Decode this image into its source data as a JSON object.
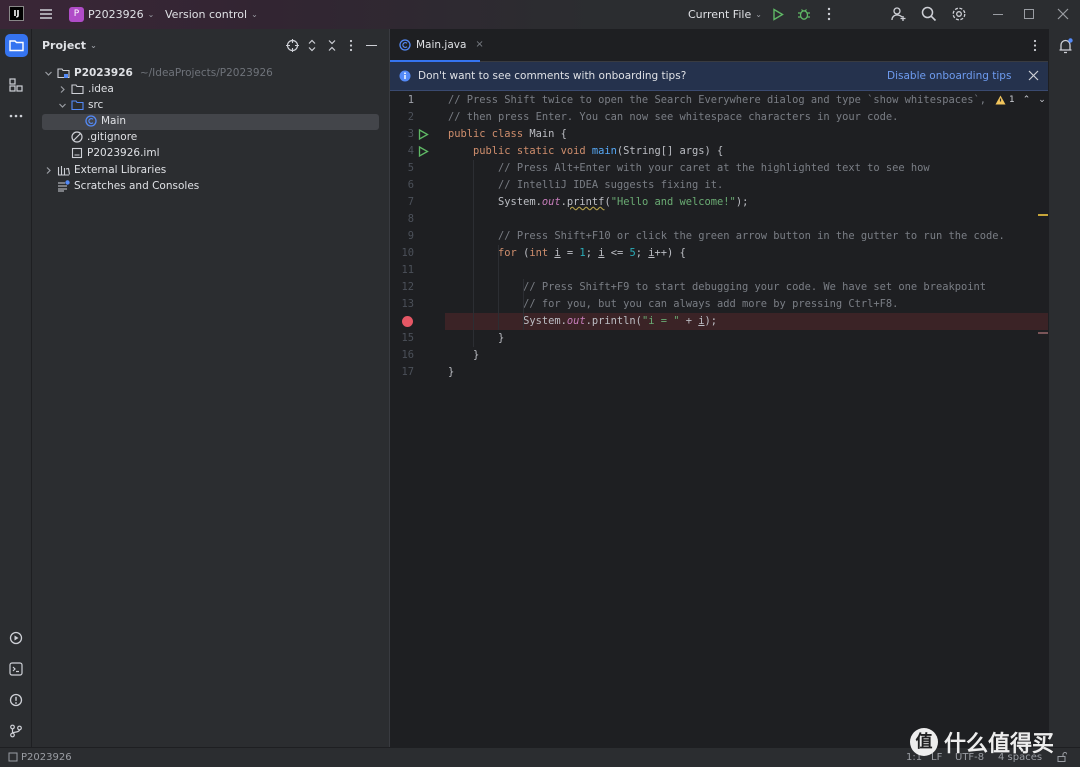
{
  "titlebar": {
    "app_logo": "IJ",
    "project_badge": "P",
    "project_name": "P2023926",
    "vcs": "Version control",
    "run_config": "Current File",
    "icons": [
      "menu-icon",
      "run-icon",
      "debug-icon",
      "more-icon",
      "add-user-icon",
      "search-icon",
      "settings-icon",
      "minimize-icon",
      "maximize-icon",
      "close-icon"
    ]
  },
  "project_panel": {
    "title": "Project",
    "tree": [
      {
        "label": "P2023926",
        "hint": "~/IdeaProjects/P2023926",
        "type": "project",
        "expanded": true,
        "depth": 0
      },
      {
        "label": ".idea",
        "type": "folder",
        "expanded": false,
        "depth": 1
      },
      {
        "label": "src",
        "type": "source-folder",
        "expanded": true,
        "depth": 1
      },
      {
        "label": "Main",
        "type": "class",
        "depth": 2,
        "selected": true
      },
      {
        "label": ".gitignore",
        "type": "ignore-file",
        "depth": 1
      },
      {
        "label": "P2023926.iml",
        "type": "module-file",
        "depth": 1
      },
      {
        "label": "External Libraries",
        "type": "libraries",
        "expanded": false,
        "depth": 0
      },
      {
        "label": "Scratches and Consoles",
        "type": "scratches",
        "depth": 0
      }
    ]
  },
  "editor": {
    "tab": "Main.java",
    "banner": {
      "text": "Don't want to see comments with onboarding tips?",
      "action": "Disable onboarding tips"
    },
    "warnings": "1",
    "current_line": 1,
    "breakpoint_line": 14,
    "run_gutter_lines": [
      3,
      4
    ],
    "lines": [
      [
        [
          "// Press Shift twice to open the Search Everywhere dialog and type `show whitespaces`,",
          "c"
        ]
      ],
      [
        [
          "// then press Enter. You can now see whitespace characters in your code.",
          "c"
        ]
      ],
      [
        [
          "public class ",
          "k"
        ],
        [
          "Main {",
          "p"
        ]
      ],
      [
        [
          "    public static void ",
          "k"
        ],
        [
          "main",
          "f"
        ],
        [
          "(String[] args) {",
          "p"
        ]
      ],
      [
        [
          "        // Press Alt+Enter with your caret at the highlighted text to see how",
          "c"
        ]
      ],
      [
        [
          "        // IntelliJ IDEA suggests fixing it.",
          "c"
        ]
      ],
      [
        [
          "        System.",
          "p"
        ],
        [
          "out",
          "st"
        ],
        [
          ".",
          "p"
        ],
        [
          "printf",
          "w"
        ],
        [
          "(",
          "p"
        ],
        [
          "\"Hello and welcome!\"",
          "s"
        ],
        [
          ");",
          "p"
        ]
      ],
      [],
      [
        [
          "        // Press Shift+F10 or click the green arrow button in the gutter to run the code.",
          "c"
        ]
      ],
      [
        [
          "        for ",
          "k"
        ],
        [
          "(",
          "p"
        ],
        [
          "int ",
          "k"
        ],
        [
          "i",
          "u"
        ],
        [
          " = ",
          "p"
        ],
        [
          "1",
          "n"
        ],
        [
          "; ",
          "p"
        ],
        [
          "i",
          "u"
        ],
        [
          " <= ",
          "p"
        ],
        [
          "5",
          "n"
        ],
        [
          "; ",
          "p"
        ],
        [
          "i",
          "u"
        ],
        [
          "++) {",
          "p"
        ]
      ],
      [],
      [
        [
          "            // Press Shift+F9 to start debugging your code. We have set one breakpoint",
          "c"
        ]
      ],
      [
        [
          "            // for you, but you can always add more by pressing Ctrl+F8.",
          "c"
        ]
      ],
      [
        [
          "            System.",
          "p"
        ],
        [
          "out",
          "st"
        ],
        [
          ".println(",
          "p"
        ],
        [
          "\"i = \"",
          "s"
        ],
        [
          " + ",
          "p"
        ],
        [
          "i",
          "u"
        ],
        [
          ");",
          "p"
        ]
      ],
      [
        [
          "        }",
          "p"
        ]
      ],
      [
        [
          "    }",
          "p"
        ]
      ],
      [
        [
          "}",
          "p"
        ]
      ]
    ]
  },
  "status_bar": {
    "breadcrumb": "P2023926",
    "position": "1:1",
    "line_separator": "LF",
    "encoding": "UTF-8",
    "indent": "4 spaces"
  },
  "watermark": {
    "badge": "值",
    "text": "什么值得买"
  },
  "colors": {
    "accent": "#3574f0",
    "run": "#5fb865",
    "breakpoint": "#e55765",
    "link": "#6e9cf0"
  }
}
